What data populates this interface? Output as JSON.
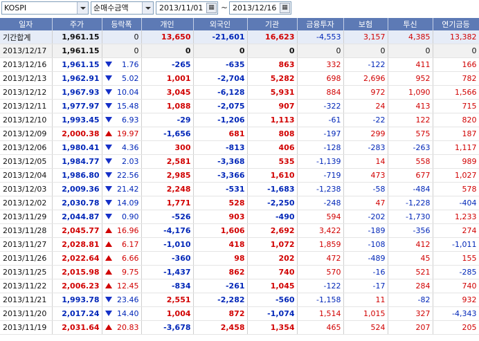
{
  "toolbar": {
    "market": "KOSPI",
    "metric": "순매수금액",
    "start_date": "2013/11/01",
    "end_date": "2013/12/16",
    "separator": "~"
  },
  "columns": [
    "일자",
    "주가",
    "등락폭",
    "개인",
    "외국인",
    "기관",
    "금융투자",
    "보험",
    "투신",
    "연기금등"
  ],
  "rows": [
    {
      "date": "기간합계",
      "price": "1,961.15",
      "dir": "",
      "chg": "0",
      "indiv": "13,650",
      "foreign": "-21,601",
      "inst": "16,623",
      "fin": "-4,553",
      "ins": "3,157",
      "trust": "4,385",
      "pension": "13,382",
      "kind": "sum"
    },
    {
      "date": "2013/12/17",
      "price": "1,961.15",
      "dir": "",
      "chg": "0",
      "indiv": "0",
      "foreign": "0",
      "inst": "0",
      "fin": "0",
      "ins": "0",
      "trust": "0",
      "pension": "0",
      "kind": "zero"
    },
    {
      "date": "2013/12/16",
      "price": "1,961.15",
      "dir": "down",
      "chg": "1.76",
      "indiv": "-265",
      "foreign": "-635",
      "inst": "863",
      "fin": "332",
      "ins": "-122",
      "trust": "411",
      "pension": "166"
    },
    {
      "date": "2013/12/13",
      "price": "1,962.91",
      "dir": "down",
      "chg": "5.02",
      "indiv": "1,001",
      "foreign": "-2,704",
      "inst": "5,282",
      "fin": "698",
      "ins": "2,696",
      "trust": "952",
      "pension": "782"
    },
    {
      "date": "2013/12/12",
      "price": "1,967.93",
      "dir": "down",
      "chg": "10.04",
      "indiv": "3,045",
      "foreign": "-6,128",
      "inst": "5,931",
      "fin": "884",
      "ins": "972",
      "trust": "1,090",
      "pension": "1,566"
    },
    {
      "date": "2013/12/11",
      "price": "1,977.97",
      "dir": "down",
      "chg": "15.48",
      "indiv": "1,088",
      "foreign": "-2,075",
      "inst": "907",
      "fin": "-322",
      "ins": "24",
      "trust": "413",
      "pension": "715"
    },
    {
      "date": "2013/12/10",
      "price": "1,993.45",
      "dir": "down",
      "chg": "6.93",
      "indiv": "-29",
      "foreign": "-1,206",
      "inst": "1,113",
      "fin": "-61",
      "ins": "-22",
      "trust": "122",
      "pension": "820"
    },
    {
      "date": "2013/12/09",
      "price": "2,000.38",
      "dir": "up",
      "chg": "19.97",
      "indiv": "-1,656",
      "foreign": "681",
      "inst": "808",
      "fin": "-197",
      "ins": "299",
      "trust": "575",
      "pension": "187"
    },
    {
      "date": "2013/12/06",
      "price": "1,980.41",
      "dir": "down",
      "chg": "4.36",
      "indiv": "300",
      "foreign": "-813",
      "inst": "406",
      "fin": "-128",
      "ins": "-283",
      "trust": "-263",
      "pension": "1,117"
    },
    {
      "date": "2013/12/05",
      "price": "1,984.77",
      "dir": "down",
      "chg": "2.03",
      "indiv": "2,581",
      "foreign": "-3,368",
      "inst": "535",
      "fin": "-1,139",
      "ins": "14",
      "trust": "558",
      "pension": "989"
    },
    {
      "date": "2013/12/04",
      "price": "1,986.80",
      "dir": "down",
      "chg": "22.56",
      "indiv": "2,985",
      "foreign": "-3,366",
      "inst": "1,610",
      "fin": "-719",
      "ins": "473",
      "trust": "677",
      "pension": "1,027"
    },
    {
      "date": "2013/12/03",
      "price": "2,009.36",
      "dir": "down",
      "chg": "21.42",
      "indiv": "2,248",
      "foreign": "-531",
      "inst": "-1,683",
      "fin": "-1,238",
      "ins": "-58",
      "trust": "-484",
      "pension": "578"
    },
    {
      "date": "2013/12/02",
      "price": "2,030.78",
      "dir": "down",
      "chg": "14.09",
      "indiv": "1,771",
      "foreign": "528",
      "inst": "-2,250",
      "fin": "-248",
      "ins": "47",
      "trust": "-1,228",
      "pension": "-404"
    },
    {
      "date": "2013/11/29",
      "price": "2,044.87",
      "dir": "down",
      "chg": "0.90",
      "indiv": "-526",
      "foreign": "903",
      "inst": "-490",
      "fin": "594",
      "ins": "-202",
      "trust": "-1,730",
      "pension": "1,233"
    },
    {
      "date": "2013/11/28",
      "price": "2,045.77",
      "dir": "up",
      "chg": "16.96",
      "indiv": "-4,176",
      "foreign": "1,606",
      "inst": "2,692",
      "fin": "3,422",
      "ins": "-189",
      "trust": "-356",
      "pension": "274"
    },
    {
      "date": "2013/11/27",
      "price": "2,028.81",
      "dir": "up",
      "chg": "6.17",
      "indiv": "-1,010",
      "foreign": "418",
      "inst": "1,072",
      "fin": "1,859",
      "ins": "-108",
      "trust": "412",
      "pension": "-1,011"
    },
    {
      "date": "2013/11/26",
      "price": "2,022.64",
      "dir": "up",
      "chg": "6.66",
      "indiv": "-360",
      "foreign": "98",
      "inst": "202",
      "fin": "472",
      "ins": "-489",
      "trust": "45",
      "pension": "155"
    },
    {
      "date": "2013/11/25",
      "price": "2,015.98",
      "dir": "up",
      "chg": "9.75",
      "indiv": "-1,437",
      "foreign": "862",
      "inst": "740",
      "fin": "570",
      "ins": "-16",
      "trust": "521",
      "pension": "-285"
    },
    {
      "date": "2013/11/22",
      "price": "2,006.23",
      "dir": "up",
      "chg": "12.45",
      "indiv": "-834",
      "foreign": "-261",
      "inst": "1,045",
      "fin": "-122",
      "ins": "-17",
      "trust": "284",
      "pension": "740"
    },
    {
      "date": "2013/11/21",
      "price": "1,993.78",
      "dir": "down",
      "chg": "23.46",
      "indiv": "2,551",
      "foreign": "-2,282",
      "inst": "-560",
      "fin": "-1,158",
      "ins": "11",
      "trust": "-82",
      "pension": "932"
    },
    {
      "date": "2013/11/20",
      "price": "2,017.24",
      "dir": "down",
      "chg": "14.40",
      "indiv": "1,004",
      "foreign": "872",
      "inst": "-1,074",
      "fin": "1,514",
      "ins": "1,015",
      "trust": "327",
      "pension": "-4,343"
    },
    {
      "date": "2013/11/19",
      "price": "2,031.64",
      "dir": "up",
      "chg": "20.83",
      "indiv": "-3,678",
      "foreign": "2,458",
      "inst": "1,354",
      "fin": "465",
      "ins": "524",
      "trust": "207",
      "pension": "205"
    }
  ],
  "colors": {
    "header_bg": "#5d7ab5",
    "up": "#d10000",
    "down": "#0026b8",
    "sum_bg": "#e6ecf7"
  }
}
